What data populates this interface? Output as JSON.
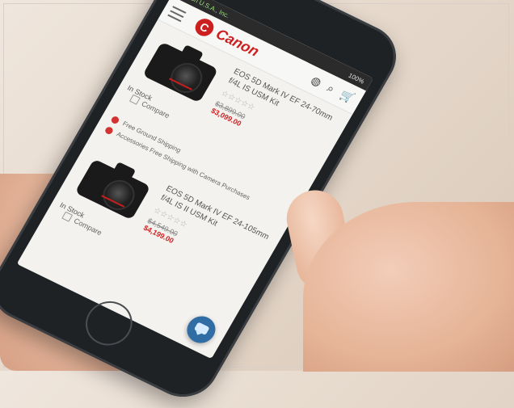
{
  "status_bar": {
    "carrier": "Canon U.S.A., Inc.",
    "right": "100%"
  },
  "brand": {
    "logo_text": "Canon"
  },
  "products": [
    {
      "title": "EOS 5D Mark IV EF 24-70mm f/4L IS USM Kit",
      "rating": "☆☆☆☆☆",
      "stock": "In Stock",
      "price_old": "$3,899.00",
      "price_new": "$3,099.00",
      "compare": "Compare"
    },
    {
      "title": "EOS 5D Mark IV EF 24-105mm f/4L IS II USM Kit",
      "rating": "☆☆☆☆☆",
      "stock": "In Stock",
      "price_old": "$4,549.00",
      "price_new": "$4,199.00",
      "compare": "Compare"
    }
  ],
  "notes": [
    "Free Ground Shipping",
    "Accessories Free Shipping with Camera Purchases"
  ],
  "colors": {
    "brand_red": "#cc1f1f",
    "chat_blue": "#2f6da4"
  },
  "icons": [
    "menu-icon",
    "user-icon",
    "search-icon",
    "cart-icon",
    "chat-icon"
  ]
}
